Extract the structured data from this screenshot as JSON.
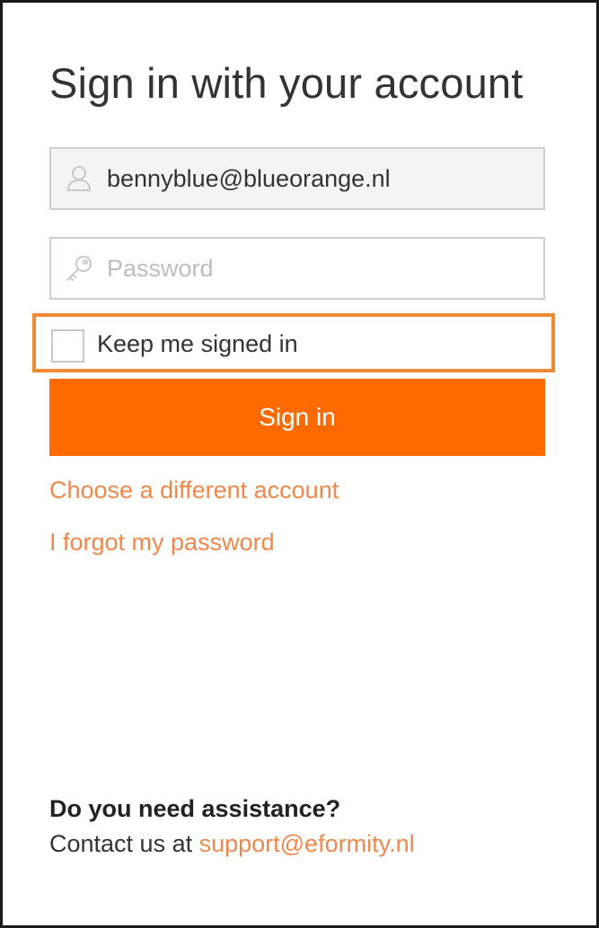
{
  "page": {
    "title": "Sign in with your account"
  },
  "form": {
    "email": {
      "value": "bennyblue@blueorange.nl",
      "icon": "user-icon"
    },
    "password": {
      "placeholder": "Password",
      "icon": "key-icon"
    },
    "keep_signed_in": {
      "label": "Keep me signed in",
      "checked": false
    },
    "submit_label": "Sign in"
  },
  "links": {
    "choose_account": "Choose a different account",
    "forgot_password": "I forgot my password"
  },
  "assistance": {
    "heading": "Do you need assistance?",
    "contact_prefix": "Contact us at ",
    "email": "support@eformity.nl"
  },
  "colors": {
    "accent": "#ff6a00",
    "link": "#f2874a",
    "focus_outline": "#f08a35",
    "text": "#333333"
  }
}
